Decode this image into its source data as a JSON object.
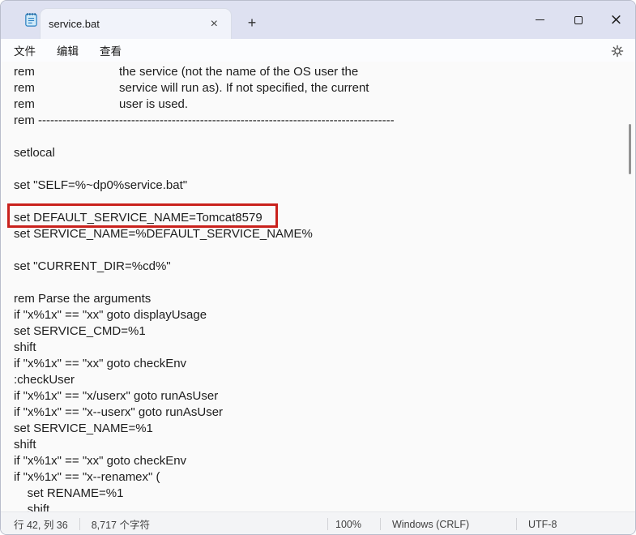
{
  "titlebar": {
    "tab_title": "service.bat"
  },
  "icons": {
    "tab_close": "×",
    "new_tab": "+",
    "window_close": "×"
  },
  "menubar": {
    "items": [
      {
        "label": "文件"
      },
      {
        "label": "编辑"
      },
      {
        "label": "查看"
      }
    ]
  },
  "editor": {
    "lines": [
      "rem                         the service (not the name of the OS user the",
      "rem                         service will run as). If not specified, the current",
      "rem                         user is used.",
      "rem ----------------------------------------------------------------------------------------",
      "",
      "setlocal",
      "",
      "set \"SELF=%~dp0%service.bat\"",
      "",
      "set DEFAULT_SERVICE_NAME=Tomcat8579",
      "set SERVICE_NAME=%DEFAULT_SERVICE_NAME%",
      "",
      "set \"CURRENT_DIR=%cd%\"",
      "",
      "rem Parse the arguments",
      "if \"x%1x\" == \"xx\" goto displayUsage",
      "set SERVICE_CMD=%1",
      "shift",
      "if \"x%1x\" == \"xx\" goto checkEnv",
      ":checkUser",
      "if \"x%1x\" == \"x/userx\" goto runAsUser",
      "if \"x%1x\" == \"x--userx\" goto runAsUser",
      "set SERVICE_NAME=%1",
      "shift",
      "if \"x%1x\" == \"xx\" goto checkEnv",
      "if \"x%1x\" == \"x--renamex\" (",
      "    set RENAME=%1",
      "    shift"
    ]
  },
  "annotation": {
    "highlighted_text": "set DEFAULT_SERVICE_NAME=Tomcat8579",
    "line_index": 9,
    "box_color": "#c9211c"
  },
  "statusbar": {
    "cursor_position": "行 42, 列 36",
    "char_count": "8,717 个字符",
    "zoom": "100%",
    "line_ending": "Windows (CRLF)",
    "encoding": "UTF-8"
  }
}
